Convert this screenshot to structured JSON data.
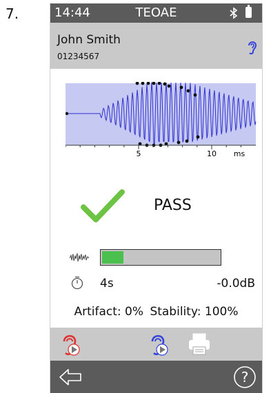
{
  "step_number": "7.",
  "status_bar": {
    "time": "14:44",
    "title": "TEOAE",
    "bluetooth_icon": "bluetooth-icon",
    "battery_icon": "battery-icon"
  },
  "patient": {
    "name": "John Smith",
    "id": "01234567",
    "ear": "right",
    "ear_color": "#3344dd"
  },
  "waveform": {
    "x_tick_labels": [
      "5",
      "10"
    ],
    "x_unit": "ms"
  },
  "result": {
    "label": "PASS",
    "check_color": "#6cc344"
  },
  "noise": {
    "icon": "noise-icon",
    "level_fraction": 0.18,
    "fill_color": "#4cc04e"
  },
  "timer": {
    "icon": "stopwatch-icon",
    "duration": "4s",
    "level": "-0.0dB"
  },
  "stats": {
    "artifact": "Artifact: 0%",
    "stability": "Stability: 100%"
  },
  "action_bar": {
    "left_ear_icon": "left-ear-play-icon",
    "left_ear_color": "#e03030",
    "right_ear_icon": "right-ear-play-icon",
    "right_ear_color": "#3344dd",
    "print_icon": "printer-icon"
  },
  "nav_bar": {
    "back_icon": "back-arrow-icon",
    "help_icon": "help-icon"
  }
}
